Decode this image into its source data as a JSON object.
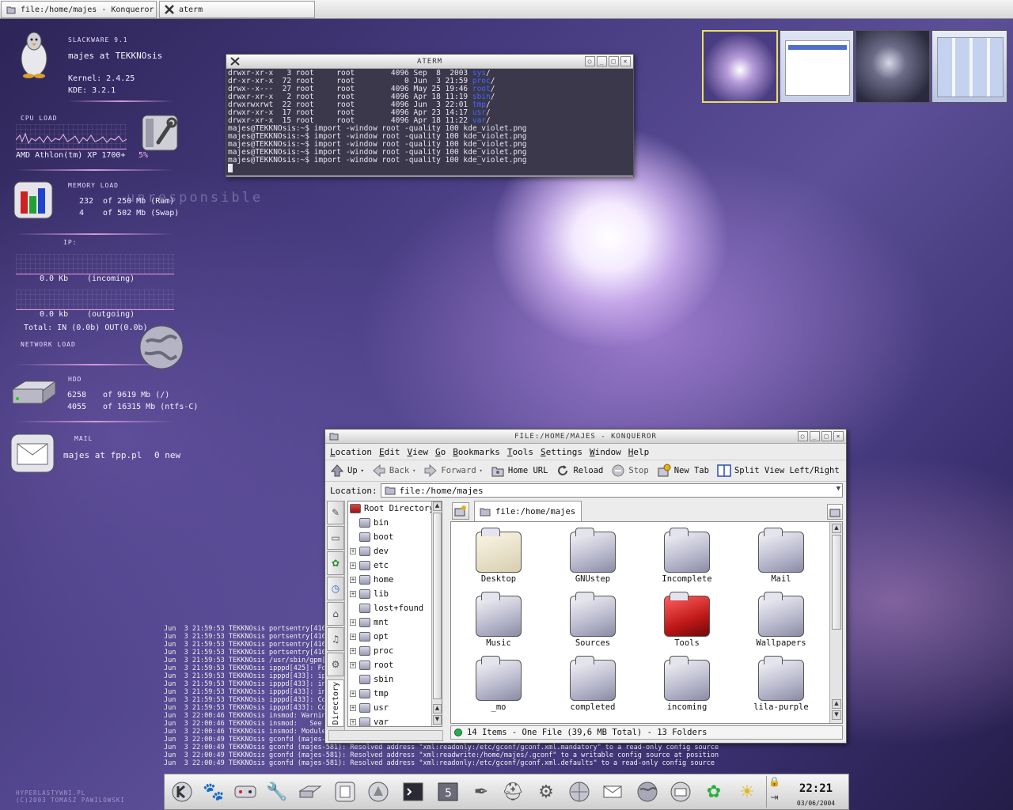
{
  "taskbar": {
    "tasks": [
      {
        "label": "file:/home/majes - Konqueror",
        "icon": "konqueror-icon"
      },
      {
        "label": "aterm",
        "icon": "x-icon"
      }
    ]
  },
  "sysmon": {
    "distro": "SLACKWARE 9.1",
    "user_host": "majes at TEKKNOsis",
    "kernel": "Kernel: 2.4.25",
    "kde": "KDE: 3.2.1",
    "cpu": {
      "header": "CPU LOAD",
      "model": "AMD Athlon(tm) XP 1700+",
      "percent": "5%"
    },
    "memory": {
      "header": "MEMORY LOAD",
      "ram_used": "232",
      "ram_text": "of 250 Mb (Ram)",
      "swap_used": "4",
      "swap_text": "of 502 Mb (Swap)",
      "watermark": "unresponsible"
    },
    "network": {
      "ip_label": "IP:",
      "incoming_value": "0.0 Kb",
      "incoming_label": "(incoming)",
      "outgoing_value": "0.0 kb",
      "outgoing_label": "(outgoing)",
      "total": "Total: IN (0.0b)  OUT(0.0b)",
      "header": "NETWORK LOAD"
    },
    "hdd": {
      "header": "HDD",
      "root_used": "6258",
      "root_text": "of 9619 Mb (/)",
      "ntfs_used": "4055",
      "ntfs_text": "of 16315 Mb (ntfs-C)"
    },
    "mail": {
      "header": "MAIL",
      "account": "majes at fpp.pl",
      "status": "0 new"
    }
  },
  "aterm": {
    "title": "ATERM",
    "lines": [
      {
        "perm": "drwxr-xr-x",
        "n": "3",
        "u": "root",
        "g": "root",
        "size": "4096",
        "date": "Sep  8  2003",
        "name": "sys"
      },
      {
        "perm": "dr-xr-xr-x",
        "n": "72",
        "u": "root",
        "g": "root",
        "size": "0",
        "date": "Jun  3 21:59",
        "name": "proc"
      },
      {
        "perm": "drwx--x---",
        "n": "27",
        "u": "root",
        "g": "root",
        "size": "4096",
        "date": "May 25 19:46",
        "name": "root"
      },
      {
        "perm": "drwxr-xr-x",
        "n": "2",
        "u": "root",
        "g": "root",
        "size": "4096",
        "date": "Apr 18 11:19",
        "name": "sbin"
      },
      {
        "perm": "drwxrwxrwt",
        "n": "22",
        "u": "root",
        "g": "root",
        "size": "4096",
        "date": "Jun  3 22:01",
        "name": "tmp"
      },
      {
        "perm": "drwxr-xr-x",
        "n": "17",
        "u": "root",
        "g": "root",
        "size": "4096",
        "date": "Apr 23 14:17",
        "name": "usr"
      },
      {
        "perm": "drwxr-xr-x",
        "n": "15",
        "u": "root",
        "g": "root",
        "size": "4096",
        "date": "Apr 18 11:22",
        "name": "var"
      }
    ],
    "commands": [
      "majes@TEKKNOsis:~$ import -window root -quality 100 kde_violet.png",
      "majes@TEKKNOsis:~$ import -window root -quality 100 kde_violet.png",
      "majes@TEKKNOsis:~$ import -window root -quality 100 kde_violet.png",
      "majes@TEKKNOsis:~$ import -window root -quality 100 kde_violet.png",
      "majes@TEKKNOsis:~$ import -window root -quality 100 kde_violet.png"
    ]
  },
  "konqueror": {
    "title": "FILE:/HOME/MAJES - KONQUEROR",
    "menu": [
      "Location",
      "Edit",
      "View",
      "Go",
      "Bookmarks",
      "Tools",
      "Settings",
      "Window",
      "Help"
    ],
    "toolbar": {
      "up": "Up",
      "back": "Back",
      "forward": "Forward",
      "home": "Home URL",
      "reload": "Reload",
      "stop": "Stop",
      "newtab": "New Tab",
      "split": "Split View Left/Right"
    },
    "location_label": "Location:",
    "location_value": "file:/home/majes",
    "tab_label": "file:/home/majes",
    "sidebar_tab": "Directory",
    "tree_root": "Root Directory",
    "tree": [
      "bin",
      "boot",
      "dev",
      "etc",
      "home",
      "lib",
      "lost+found",
      "mnt",
      "opt",
      "proc",
      "root",
      "sbin",
      "tmp",
      "usr",
      "var"
    ],
    "files": [
      "Desktop",
      "GNUstep",
      "Incomplete",
      "Mail",
      "Music",
      "Sources",
      "Tools",
      "Wallpapers",
      "_mo",
      "completed",
      "incoming",
      "lila-purple"
    ],
    "status": "14 Items - One File (39,6 MB Total) - 13 Folders"
  },
  "syslog": [
    "Jun  3 21:59:53 TEKKNOsis portsentry[416",
    "Jun  3 21:59:53 TEKKNOsis portsentry[416",
    "Jun  3 21:59:53 TEKKNOsis portsentry[416",
    "Jun  3 21:59:53 TEKKNOsis portsentry[416",
    "Jun  3 21:59:53 TEKKNOsis /usr/sbin/gpm[",
    "Jun  3 21:59:53 TEKKNOsis ipppd[425]: Fo",
    "Jun  3 21:59:53 TEKKNOsis ipppd[433]: ip",
    "Jun  3 21:59:53 TEKKNOsis ipppd[433]: in",
    "Jun  3 21:59:53 TEKKNOsis ipppd[433]: in",
    "Jun  3 21:59:53 TEKKNOsis ipppd[433]: Co",
    "Jun  3 21:59:53 TEKKNOsis ipppd[433]: Co",
    "Jun  3 22:00:46 TEKKNOsis insmod: Warnin",
    "Jun  3 22:00:46 TEKKNOsis insmod:   See h",
    "Jun  3 22:00:46 TEKKNOsis insmod: Module",
    "Jun  3 22:00:49 TEKKNOsis gconfd (majes-",
    "Jun  3 22:00:49 TEKKNOsis gconfd (majes-581): Resolved address \"xml:readonly:/etc/gconf/gconf.xml.mandatory\" to a read-only config source",
    "Jun  3 22:00:49 TEKKNOsis gconfd (majes-581): Resolved address \"xml:readwrite:/home/majes/.gconf\" to a writable config source at position",
    "Jun  3 22:00:49 TEKKNOsis gconfd (majes-581): Resolved address \"xml:readonly:/etc/gconf/gconf.xml.defaults\" to a read-only config source"
  ],
  "credits": {
    "line1": "HYPERLASTYWNI.PL",
    "line2": "(C)2003  TOMASZ PAWILOWSKI"
  },
  "clock": {
    "time": "22:21",
    "date": "03/06/2004"
  }
}
